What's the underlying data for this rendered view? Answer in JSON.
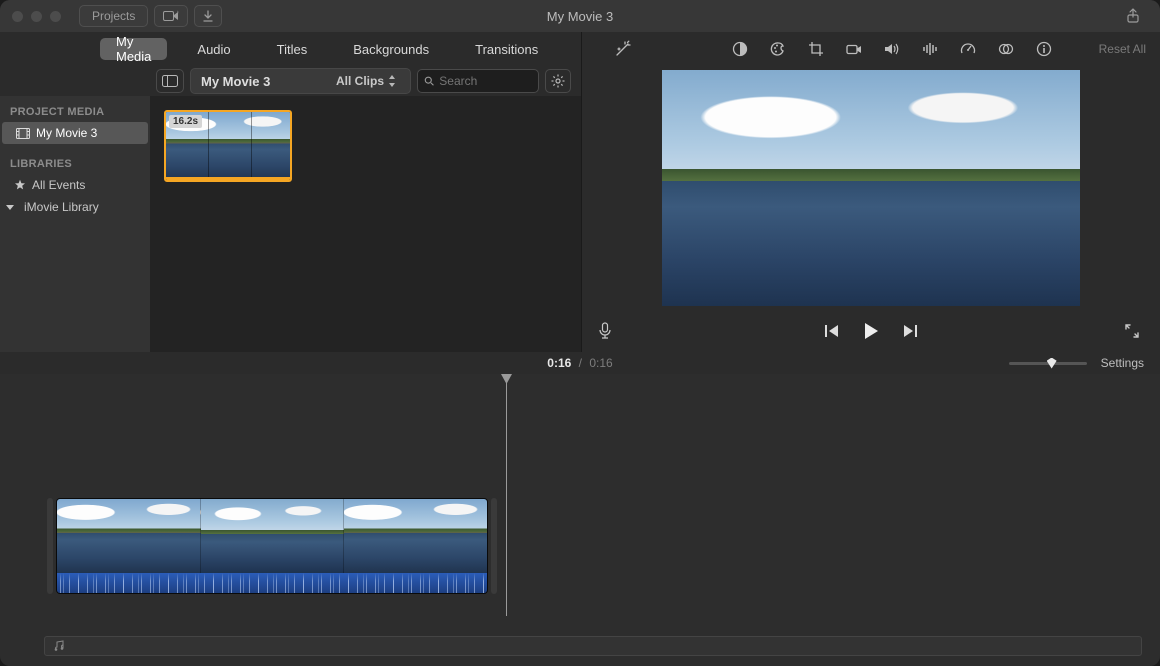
{
  "window": {
    "title": "My Movie 3",
    "projects_btn": "Projects"
  },
  "tabs": {
    "my_media": "My Media",
    "audio": "Audio",
    "titles": "Titles",
    "backgrounds": "Backgrounds",
    "transitions": "Transitions",
    "active": "my_media"
  },
  "browser_bar": {
    "clip_header": "My Movie 3",
    "filter_label": "All Clips",
    "search_placeholder": "Search"
  },
  "sidebar": {
    "project_media_head": "PROJECT MEDIA",
    "project_item": "My Movie 3",
    "libraries_head": "LIBRARIES",
    "all_events": "All Events",
    "imovie_library": "iMovie Library"
  },
  "clip": {
    "duration_badge": "16.2s"
  },
  "adjust": {
    "reset_all": "Reset All",
    "icons": [
      "magic-wand-icon",
      "contrast-icon",
      "palette-icon",
      "crop-icon",
      "camera-icon",
      "volume-icon",
      "equalizer-icon",
      "speed-dial-icon",
      "overlay-icon",
      "info-icon"
    ]
  },
  "timebar": {
    "current": "0:16",
    "sep": "/",
    "total": "0:16",
    "settings": "Settings"
  },
  "icons": {
    "media_import": "media-import-icon",
    "download": "download-icon",
    "share": "share-icon",
    "sidebar_toggle": "sidebar-toggle-icon",
    "gear": "gear-icon",
    "search": "search-icon",
    "mic": "microphone-icon",
    "prev": "skip-back-icon",
    "play": "play-icon",
    "next": "skip-forward-icon",
    "full": "fullscreen-icon",
    "music": "music-track-icon",
    "updown": "sort-arrows-icon",
    "star": "star-icon",
    "film": "film-icon",
    "library_tri": "disclosure-triangle-icon"
  }
}
